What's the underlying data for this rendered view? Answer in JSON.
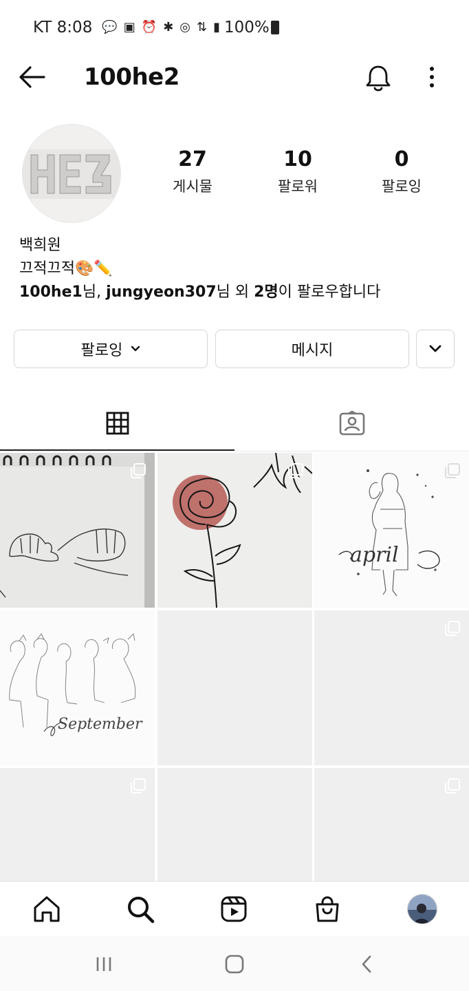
{
  "status_bar": {
    "carrier": "KT",
    "time": "8:08",
    "battery_text": "100%"
  },
  "header": {
    "username": "100he2"
  },
  "profile": {
    "stats": [
      {
        "value": "27",
        "label": "게시물"
      },
      {
        "value": "10",
        "label": "팔로워"
      },
      {
        "value": "0",
        "label": "팔로잉"
      }
    ],
    "name": "백희원",
    "bio": "끄적끄적🎨✏️",
    "followed_by": {
      "user1": "100he1",
      "sep1": "님, ",
      "user2": "jungyeon307",
      "sep2": "님 외 ",
      "count": "2명",
      "suffix": "이 팔로우합니다"
    }
  },
  "actions": {
    "following_label": "팔로잉",
    "message_label": "메시지"
  },
  "tabs": [
    {
      "icon": "grid-icon",
      "active": true
    },
    {
      "icon": "tagged-icon",
      "active": false
    }
  ],
  "posts": {
    "tile3_text": "april",
    "tile4_text": "September"
  },
  "colors": {
    "accent_dark": "#222222",
    "border": "#d5d5d5",
    "placeholder_tile": "#efefef",
    "rose": "#b5554f"
  }
}
